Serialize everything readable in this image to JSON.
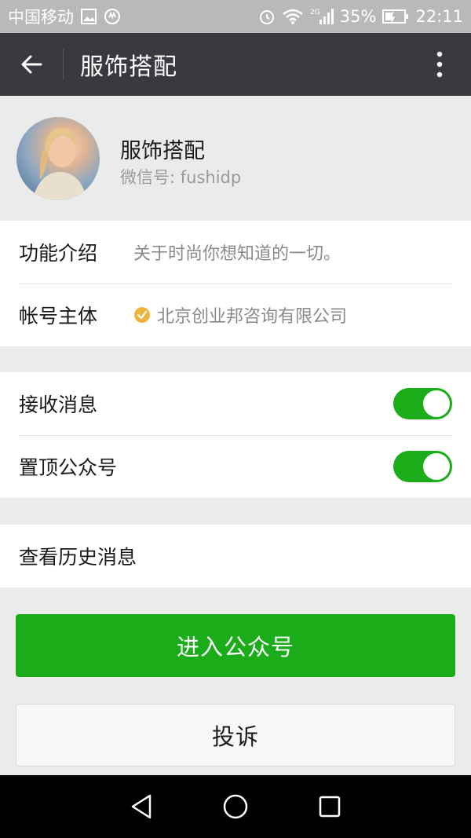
{
  "status_bar": {
    "carrier": "中国移动",
    "network": "2G",
    "battery": "35%",
    "time": "22:11"
  },
  "titlebar": {
    "title": "服饰搭配"
  },
  "profile": {
    "name": "服饰搭配",
    "wechat_id": "微信号: fushidp"
  },
  "info": {
    "rows": [
      {
        "label": "功能介绍",
        "value": "关于时尚你想知道的一切。"
      },
      {
        "label": "帐号主体",
        "value": "北京创业邦咨询有限公司"
      }
    ]
  },
  "settings": {
    "rows": [
      {
        "label": "接收消息",
        "on": true
      },
      {
        "label": "置顶公众号",
        "on": true
      }
    ]
  },
  "history": {
    "label": "查看历史消息"
  },
  "buttons": {
    "enter": "进入公众号",
    "complain": "投诉"
  },
  "colors": {
    "accent_green": "#1aad19",
    "titlebar_bg": "#393a3f",
    "verified_badge": "#f0b43c"
  }
}
